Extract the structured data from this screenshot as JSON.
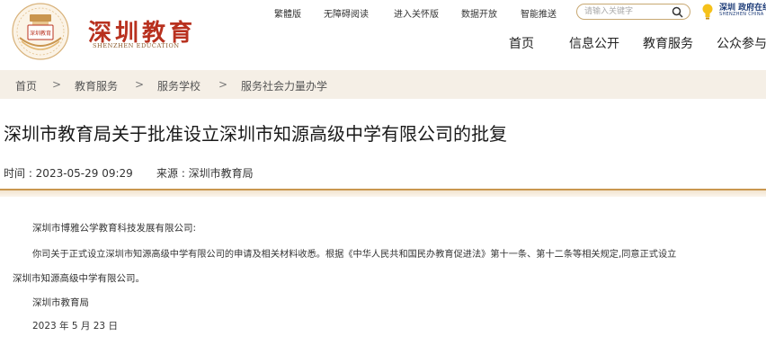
{
  "header": {
    "logo_title": "深圳教育",
    "logo_subtitle": "SHENZHEN EDUCATION",
    "emblem_text": "深圳教育",
    "toplinks": [
      "繁體版",
      "无障碍阅读",
      "进入关怀版",
      "数据开放",
      "智能推送"
    ],
    "search_placeholder": "请输入关键字",
    "sz_china_top": "深圳 政府在线",
    "sz_china_bottom": "SHENZHEN CHINA",
    "nav": [
      "首页",
      "信息公开",
      "教育服务",
      "公众参与"
    ]
  },
  "breadcrumb": {
    "items": [
      "首页",
      "教育服务",
      "服务学校",
      "服务社会力量办学"
    ],
    "separator": ">"
  },
  "article": {
    "title": "深圳市教育局关于批准设立深圳市知源高级中学有限公司的批复",
    "time": "时间 : 2023-05-29 09:29",
    "source": "来源 : 深圳市教育局",
    "recipient": "深圳市博雅公学教育科技发展有限公司:",
    "body_line1": "你司关于正式设立深圳市知源高级中学有限公司的申请及相关材料收悉。根据《中华人民共和国民办教育促进法》第十一条、第十二条等相关规定,同意正式设立",
    "body_line2": "深圳市知源高级中学有限公司。",
    "signature": "深圳市教育局",
    "date": "2023 年 5 月 23 日"
  },
  "colors": {
    "brand_red": "#b8311f",
    "gold": "#c99750",
    "breadcrumb_bg": "#f5efe6"
  }
}
